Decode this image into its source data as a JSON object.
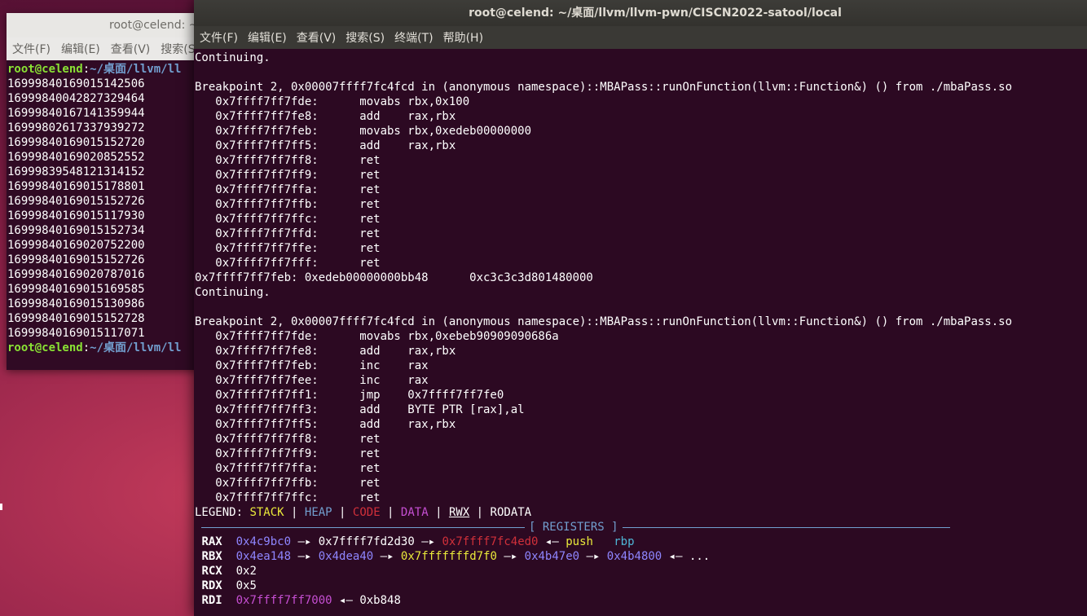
{
  "back_terminal": {
    "title": "root@celend: ~",
    "menu": [
      "文件(F)",
      "编辑(E)",
      "查看(V)",
      "搜索(S)"
    ],
    "prompt_user": "root@celend",
    "prompt_sep": ":",
    "prompt_path": "~/桌面/llvm/ll",
    "output": [
      "16999840169015142506",
      "16999840042827329464",
      "16999840167141359944",
      "16999802617337939272",
      "16999840169015152720",
      "16999840169020852552",
      "16999839548121314152",
      "16999840169015178801",
      "16999840169015152726",
      "16999840169015117930",
      "16999840169015152734",
      "16999840169020752200",
      "16999840169015152726",
      "16999840169020787016",
      "16999840169015169585",
      "16999840169015130986",
      "16999840169015152728",
      "16999840169015117071"
    ]
  },
  "front_terminal": {
    "title": "root@celend: ~/桌面/llvm/llvm-pwn/CISCN2022-satool/local",
    "menu": [
      "文件(F)",
      "编辑(E)",
      "查看(V)",
      "搜索(S)",
      "终端(T)",
      "帮助(H)"
    ],
    "lines": [
      "Continuing.",
      "",
      "Breakpoint 2, 0x00007ffff7fc4fcd in (anonymous namespace)::MBAPass::runOnFunction(llvm::Function&) () from ./mbaPass.so",
      "   0x7ffff7ff7fde:      movabs rbx,0x100",
      "   0x7ffff7ff7fe8:      add    rax,rbx",
      "   0x7ffff7ff7feb:      movabs rbx,0xedeb00000000",
      "   0x7ffff7ff7ff5:      add    rax,rbx",
      "   0x7ffff7ff7ff8:      ret",
      "   0x7ffff7ff7ff9:      ret",
      "   0x7ffff7ff7ffa:      ret",
      "   0x7ffff7ff7ffb:      ret",
      "   0x7ffff7ff7ffc:      ret",
      "   0x7ffff7ff7ffd:      ret",
      "   0x7ffff7ff7ffe:      ret",
      "   0x7ffff7ff7fff:      ret",
      "0x7ffff7ff7feb: 0xedeb00000000bb48      0xc3c3c3d801480000",
      "Continuing.",
      "",
      "Breakpoint 2, 0x00007ffff7fc4fcd in (anonymous namespace)::MBAPass::runOnFunction(llvm::Function&) () from ./mbaPass.so",
      "   0x7ffff7ff7fde:      movabs rbx,0xebeb90909090686a",
      "   0x7ffff7ff7fe8:      add    rax,rbx",
      "   0x7ffff7ff7feb:      inc    rax",
      "   0x7ffff7ff7fee:      inc    rax",
      "   0x7ffff7ff7ff1:      jmp    0x7ffff7ff7fe0",
      "   0x7ffff7ff7ff3:      add    BYTE PTR [rax],al",
      "   0x7ffff7ff7ff5:      add    rax,rbx",
      "   0x7ffff7ff7ff8:      ret",
      "   0x7ffff7ff7ff9:      ret",
      "   0x7ffff7ff7ffa:      ret",
      "   0x7ffff7ff7ffb:      ret",
      "   0x7ffff7ff7ffc:      ret"
    ],
    "legend": {
      "label": "LEGEND: ",
      "stack": "STACK",
      "heap": "HEAP",
      "code": "CODE",
      "data": "DATA",
      "rwx": "RWX",
      "rodata": "RODATA",
      "sep": " | "
    },
    "registers_header": "[ REGISTERS ]",
    "registers": {
      "rax": {
        "name": "RAX",
        "v1": "0x4c9bc0",
        "v2": "0x7ffff7fd2d30",
        "v3": "0x7ffff7fc4ed0",
        "instr": "push",
        "operand": "rbp"
      },
      "rbx": {
        "name": "RBX",
        "v1": "0x4ea148",
        "v2": "0x4dea40",
        "v3": "0x7fffffffd7f0",
        "v4": "0x4b47e0",
        "v5": "0x4b4800",
        "tail": "..."
      },
      "rcx": {
        "name": "RCX",
        "v1": "0x2"
      },
      "rdx": {
        "name": "RDX",
        "v1": "0x5"
      },
      "rdi": {
        "name": "RDI",
        "v1": "0x7ffff7ff7000",
        "v2": "0xb848"
      }
    },
    "arrow_right": " —▸ ",
    "arrow_left": " ◂— "
  },
  "colors": {
    "desktop": "#8e2148",
    "terminal_bg": "#2c0922",
    "prompt_user": "#8ae234",
    "prompt_path": "#729fcf",
    "stack": "#e9e93a",
    "code": "#d0303a",
    "data": "#c64fd3"
  }
}
